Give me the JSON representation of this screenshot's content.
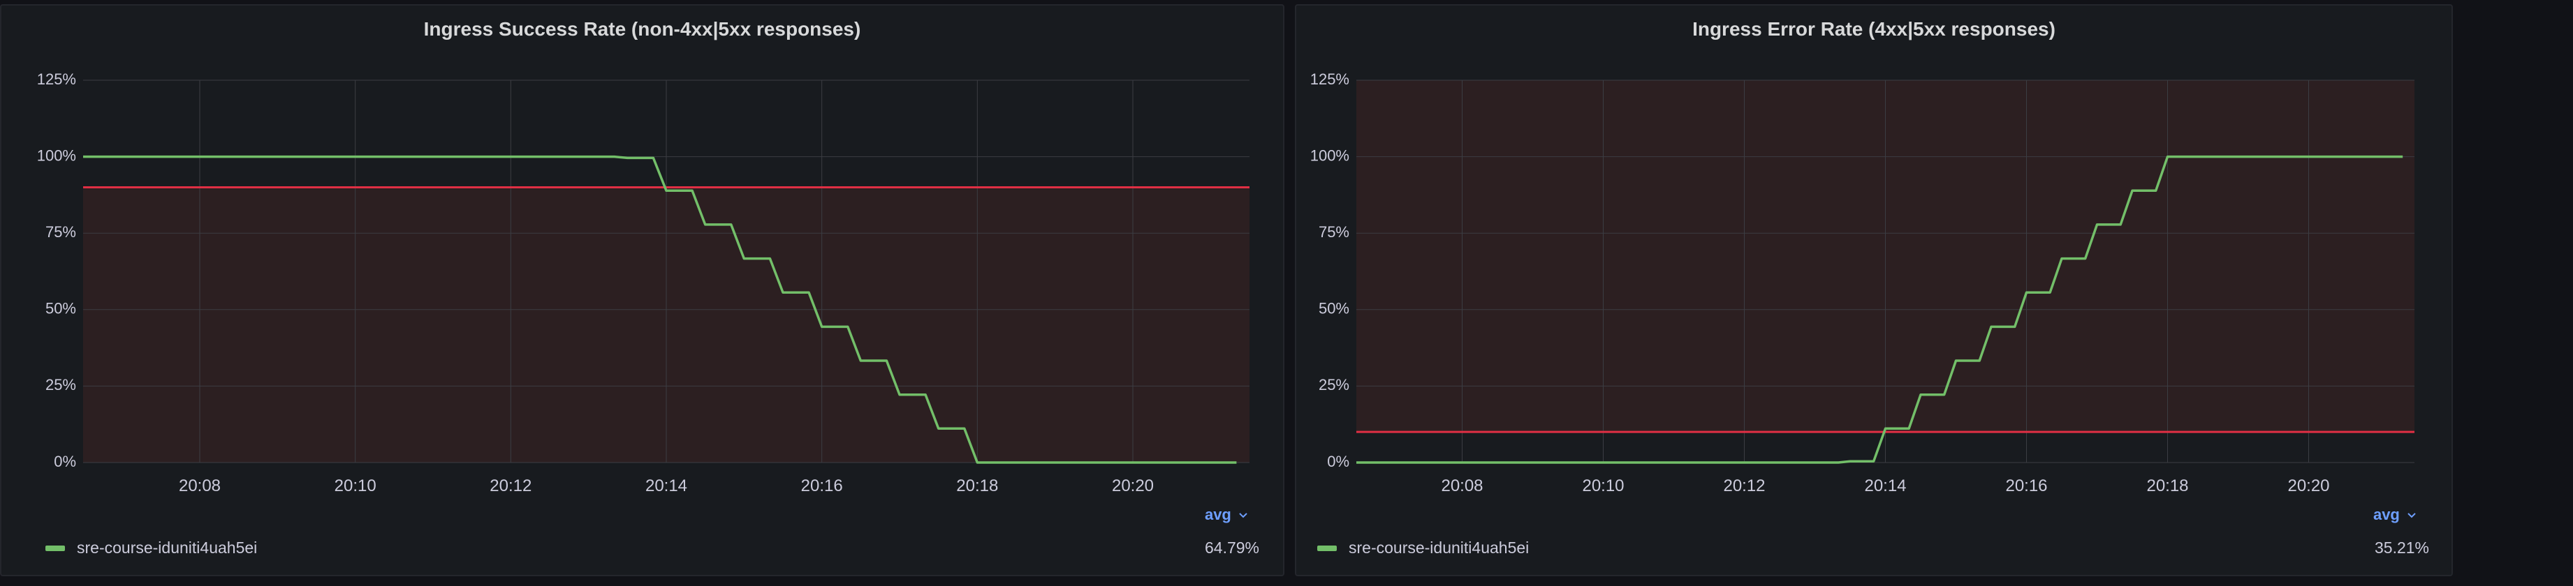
{
  "colors": {
    "series": "#73bf69",
    "threshold": "#e02f44",
    "threshold_fill": "#2c1f21",
    "grid": "#3b3d43",
    "legend_header": "#6e9fff"
  },
  "chart_data": [
    {
      "type": "line",
      "title": "Ingress Success Rate (non-4xx|5xx responses)",
      "xlabel": "",
      "ylabel": "",
      "x_ticks": [
        "20:08",
        "20:10",
        "20:12",
        "20:14",
        "20:16",
        "20:18",
        "20:20"
      ],
      "y_ticks": [
        "0%",
        "25%",
        "50%",
        "75%",
        "100%",
        "125%"
      ],
      "xlim": [
        "20:06:30",
        "20:21:30"
      ],
      "ylim": [
        0,
        125
      ],
      "threshold": {
        "value": 90,
        "region": "below"
      },
      "legend": {
        "header": "avg",
        "placement": "bottom",
        "items": [
          {
            "name": "sre-course-iduniti4uah5ei",
            "value": "64.79%"
          }
        ]
      },
      "series": [
        {
          "name": "sre-course-iduniti4uah5ei",
          "points": [
            [
              "20:06:30",
              100
            ],
            [
              "20:13:20",
              100
            ],
            [
              "20:13:30",
              99.6
            ],
            [
              "20:13:50",
              99.6
            ],
            [
              "20:14:00",
              88.9
            ],
            [
              "20:14:20",
              88.9
            ],
            [
              "20:14:30",
              77.8
            ],
            [
              "20:14:50",
              77.8
            ],
            [
              "20:15:00",
              66.7
            ],
            [
              "20:15:20",
              66.7
            ],
            [
              "20:15:30",
              55.6
            ],
            [
              "20:15:50",
              55.6
            ],
            [
              "20:16:00",
              44.4
            ],
            [
              "20:16:20",
              44.4
            ],
            [
              "20:16:30",
              33.3
            ],
            [
              "20:16:50",
              33.3
            ],
            [
              "20:17:00",
              22.2
            ],
            [
              "20:17:20",
              22.2
            ],
            [
              "20:17:30",
              11.1
            ],
            [
              "20:17:50",
              11.1
            ],
            [
              "20:18:00",
              0
            ],
            [
              "20:21:20",
              0
            ]
          ]
        }
      ]
    },
    {
      "type": "line",
      "title": "Ingress Error Rate (4xx|5xx responses)",
      "xlabel": "",
      "ylabel": "",
      "x_ticks": [
        "20:08",
        "20:10",
        "20:12",
        "20:14",
        "20:16",
        "20:18",
        "20:20"
      ],
      "y_ticks": [
        "0%",
        "25%",
        "50%",
        "75%",
        "100%",
        "125%"
      ],
      "xlim": [
        "20:06:30",
        "20:21:30"
      ],
      "ylim": [
        0,
        125
      ],
      "threshold": {
        "value": 10,
        "region": "above"
      },
      "legend": {
        "header": "avg",
        "placement": "bottom",
        "items": [
          {
            "name": "sre-course-iduniti4uah5ei",
            "value": "35.21%"
          }
        ]
      },
      "series": [
        {
          "name": "sre-course-iduniti4uah5ei",
          "points": [
            [
              "20:06:30",
              0
            ],
            [
              "20:13:20",
              0
            ],
            [
              "20:13:30",
              0.4
            ],
            [
              "20:13:50",
              0.4
            ],
            [
              "20:14:00",
              11.1
            ],
            [
              "20:14:20",
              11.1
            ],
            [
              "20:14:30",
              22.2
            ],
            [
              "20:14:50",
              22.2
            ],
            [
              "20:15:00",
              33.3
            ],
            [
              "20:15:20",
              33.3
            ],
            [
              "20:15:30",
              44.4
            ],
            [
              "20:15:50",
              44.4
            ],
            [
              "20:16:00",
              55.6
            ],
            [
              "20:16:20",
              55.6
            ],
            [
              "20:16:30",
              66.7
            ],
            [
              "20:16:50",
              66.7
            ],
            [
              "20:17:00",
              77.8
            ],
            [
              "20:17:20",
              77.8
            ],
            [
              "20:17:30",
              88.9
            ],
            [
              "20:17:50",
              88.9
            ],
            [
              "20:18:00",
              100
            ],
            [
              "20:21:20",
              100
            ]
          ]
        }
      ]
    }
  ]
}
